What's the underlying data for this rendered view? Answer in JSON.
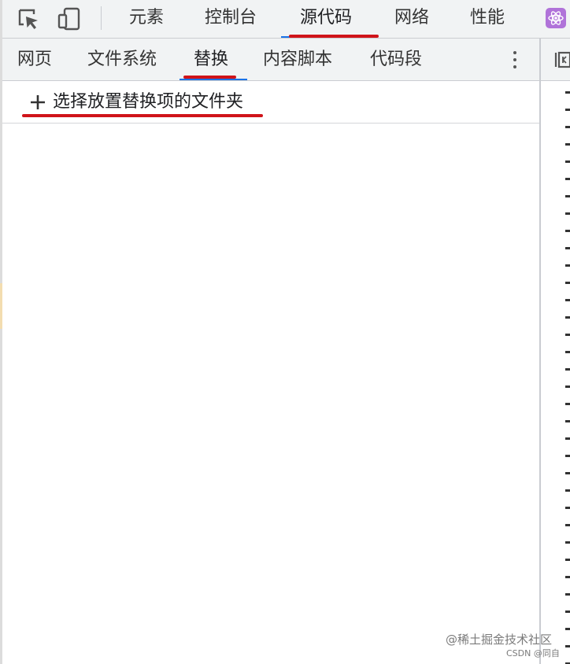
{
  "main_tabs": [
    {
      "label": "元素"
    },
    {
      "label": "控制台"
    },
    {
      "label": "源代码",
      "active": true
    },
    {
      "label": "网络"
    },
    {
      "label": "性能"
    }
  ],
  "sub_tabs": [
    {
      "label": "网页"
    },
    {
      "label": "文件系统"
    },
    {
      "label": "替换",
      "active": true
    },
    {
      "label": "内容脚本"
    },
    {
      "label": "代码段"
    }
  ],
  "overrides": {
    "add_folder_label": "选择放置替换项的文件夹"
  },
  "watermark": {
    "line1": "@稀土掘金技术社区",
    "line2": "CSDN @同自"
  },
  "colors": {
    "toolbar_bg": "#f1f3f4",
    "active_underline": "#1a73e8",
    "annotation_red": "#d0141a",
    "react_badge": "#b073d9"
  },
  "icons": [
    "inspect-element-icon",
    "device-toolbar-icon",
    "react-devtools-icon",
    "more-options-icon",
    "toggle-sidebar-icon",
    "plus-icon"
  ]
}
